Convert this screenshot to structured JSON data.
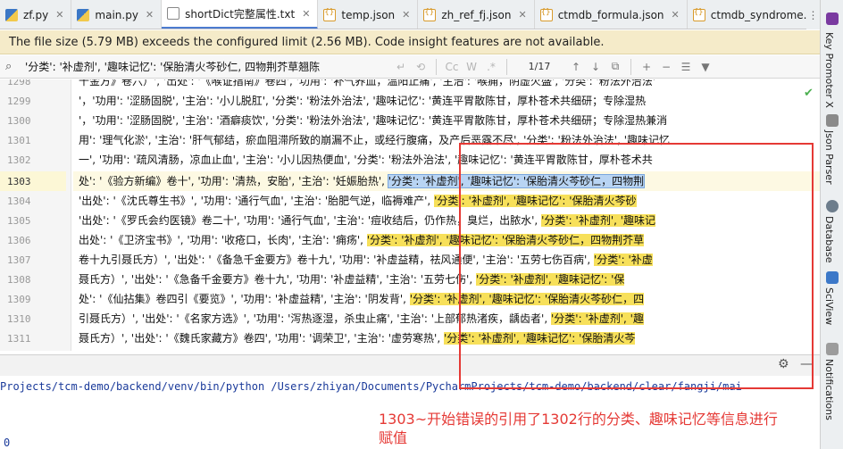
{
  "tabs": [
    {
      "label": "zf.py",
      "icon": "python-file-icon"
    },
    {
      "label": "main.py",
      "icon": "python-file-icon"
    },
    {
      "label": "shortDict完整属性.txt",
      "icon": "text-file-icon",
      "active": true
    },
    {
      "label": "temp.json",
      "icon": "json-file-icon"
    },
    {
      "label": "zh_ref_fj.json",
      "icon": "json-file-icon"
    },
    {
      "label": "ctmdb_formula.json",
      "icon": "json-file-icon"
    },
    {
      "label": "ctmdb_syndrome.json",
      "icon": "json-file-icon"
    }
  ],
  "banner": {
    "text": "The file size (5.79 MB) exceeds the configured limit (2.56 MB). Code insight features are not available."
  },
  "search": {
    "query": "'分类': '补虚剂', '趣味记忆': '保胎清火芩砂仁, 四物荆芥草翘陈",
    "match_count": "1/17",
    "buttons": {
      "case": "Cc",
      "words": "W",
      "regex": ".*"
    }
  },
  "editor": {
    "line_numbers": [
      "1298",
      "1299",
      "1300",
      "1301",
      "1302",
      "1303",
      "1304",
      "1305",
      "1306",
      "1307",
      "1308",
      "1309",
      "1310",
      "1311"
    ],
    "lines": [
      {
        "pre": "千金方》卷六）', '出处': '《喉证指南》卷四', '功用': '补气养血，温阳止痛', '主治': '喉痈，阴虚火盛', '分类': '粉法外治法'"
      },
      {
        "pre": "'，'功用': '涩肠固脱', '主治': '小儿脱肛', '分类': '粉法外治法', '趣味记忆': '黄连平胃散陈甘，厚朴苍术共细研；专除湿热"
      },
      {
        "pre": "'，'功用': '涩肠固脱', '主治': '酒癖痰饮', '分类': '粉法外治法', '趣味记忆': '黄连平胃散陈甘，厚朴苍术共细研；专除湿热兼消"
      },
      {
        "pre": "用': '理气化淤', '主治': '肝气郁结，瘀血阻滞所致的崩漏不止，或经行腹痛，及产后恶露不尽', '分类': '粉法外治法', '趣味记忆"
      },
      {
        "pre": "一', '功用': '疏风清肠，凉血止血', '主治': '小儿因热便血', '分类': '粉法外治法', '趣味记忆': '黄连平胃散陈甘，厚朴苍术共"
      },
      {
        "pre": "处': '《验方新编》卷十', '功用': '清热，安胎', '主治': '妊娠胎热', ",
        "sel": "'分类': '补虚剂', '趣味记忆': '保胎清火芩砂仁，四物荆"
      },
      {
        "pre": "'出处': '《沈氏尊生书》', '功用': '通行气血', '主治': '胎肥气逆，临褥难产', ",
        "hl": "'分类': '补虚剂', '趣味记忆': '保胎清火芩砂"
      },
      {
        "pre": "'出处': '《罗氏会约医镜》卷二十', '功用': '通行气血', '主治': '痘收结后，仍作热，臭烂，出脓水', ",
        "hl": "'分类': '补虚剂', '趣味记"
      },
      {
        "pre": "出处': '《卫济宝书》', '功用': '收疮口，长肉', '主治': '痈疡', ",
        "hl": "'分类': '补虚剂', '趣味记忆': '保胎清火芩砂仁，四物荆芥草"
      },
      {
        "pre": "卷十九引聂氏方）', '出处': '《备急千金要方》卷十九', '功用': '补虚益精，祛风通便', '主治': '五劳七伤百病', ",
        "hl": "'分类': '补虚"
      },
      {
        "pre": "聂氏方）', '出处': '《急备千金要方》卷十九', '功用': '补虚益精', '主治': '五劳七伤', ",
        "hl": "'分类': '补虚剂', '趣味记忆': '保"
      },
      {
        "pre": "处': '《仙拈集》卷四引《要览》', '功用': '补虚益精', '主治': '阴发背', ",
        "hl": "'分类': '补虚剂', '趣味记忆': '保胎清火芩砂仁，四"
      },
      {
        "pre": "引聂氏方）', '出处': '《名家方选》', '功用': '泻热逐湿，杀虫止痛', '主治': '上部郁热渚疾，龋齿者', ",
        "hl": "'分类': '补虚剂', '趣"
      },
      {
        "pre": "聂氏方）', '出处': '《魏氏家藏方》卷四', '功用': '调荣卫', '主治': '虚劳寒热', ",
        "hl": "'分类': '补虚剂', '趣味记忆': '保胎清火芩"
      }
    ]
  },
  "run": {
    "command": "Projects/tcm-demo/backend/venv/bin/python /Users/zhiyan/Documents/PycharmProjects/tcm-demo/backend/clear/fangji/mai",
    "exit_partial": "0"
  },
  "annotation": {
    "text": "1303~开始错误的引用了1302行的分类、趣味记忆等信息进行赋值"
  },
  "right_tools": {
    "key_promoter": "Key Promoter X",
    "json_parser": "Json Parser",
    "database": "Database",
    "sciview": "SciView",
    "notifications": "Notifications"
  },
  "colors": {
    "highlight": "#f7e05a",
    "selection": "#b8d4f3",
    "annotation": "#e53935",
    "banner": "#f5ebc9"
  }
}
